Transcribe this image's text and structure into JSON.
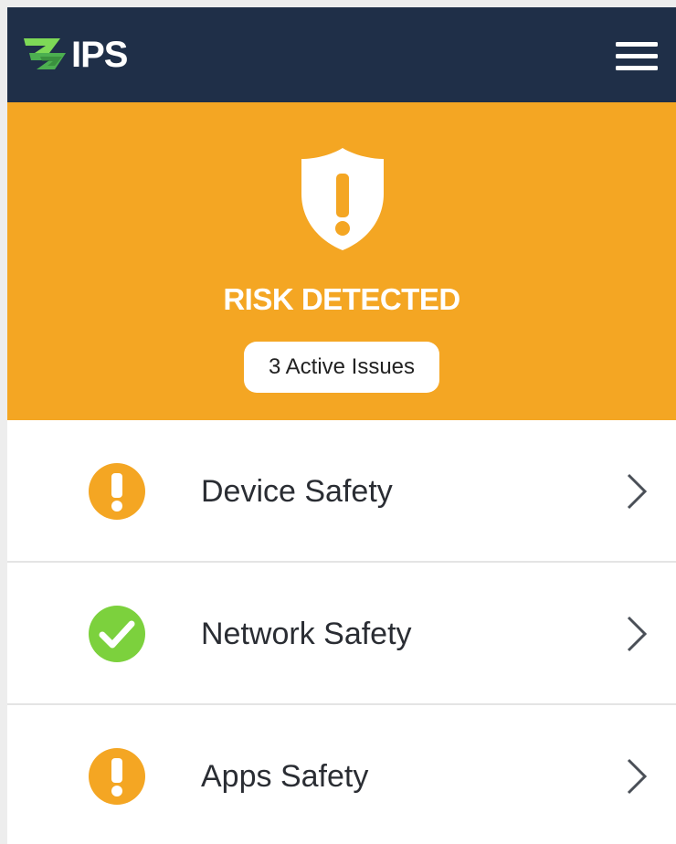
{
  "header": {
    "logo_text": "IPS",
    "logo_icon": "ips-logo-arrows",
    "menu_icon": "hamburger-menu-icon"
  },
  "status": {
    "icon": "shield-alert-icon",
    "title": "RISK DETECTED",
    "issues_label": "3 Active Issues",
    "color": "#f4a623"
  },
  "items": [
    {
      "label": "Device Safety",
      "status": "warning",
      "icon": "alert-circle-icon"
    },
    {
      "label": "Network Safety",
      "status": "ok",
      "icon": "check-circle-icon"
    },
    {
      "label": "Apps Safety",
      "status": "warning",
      "icon": "alert-circle-icon"
    }
  ],
  "colors": {
    "header_bg": "#1f2f48",
    "warning": "#f4a623",
    "ok": "#7cd13d",
    "logo_green": "#5fc14a"
  }
}
